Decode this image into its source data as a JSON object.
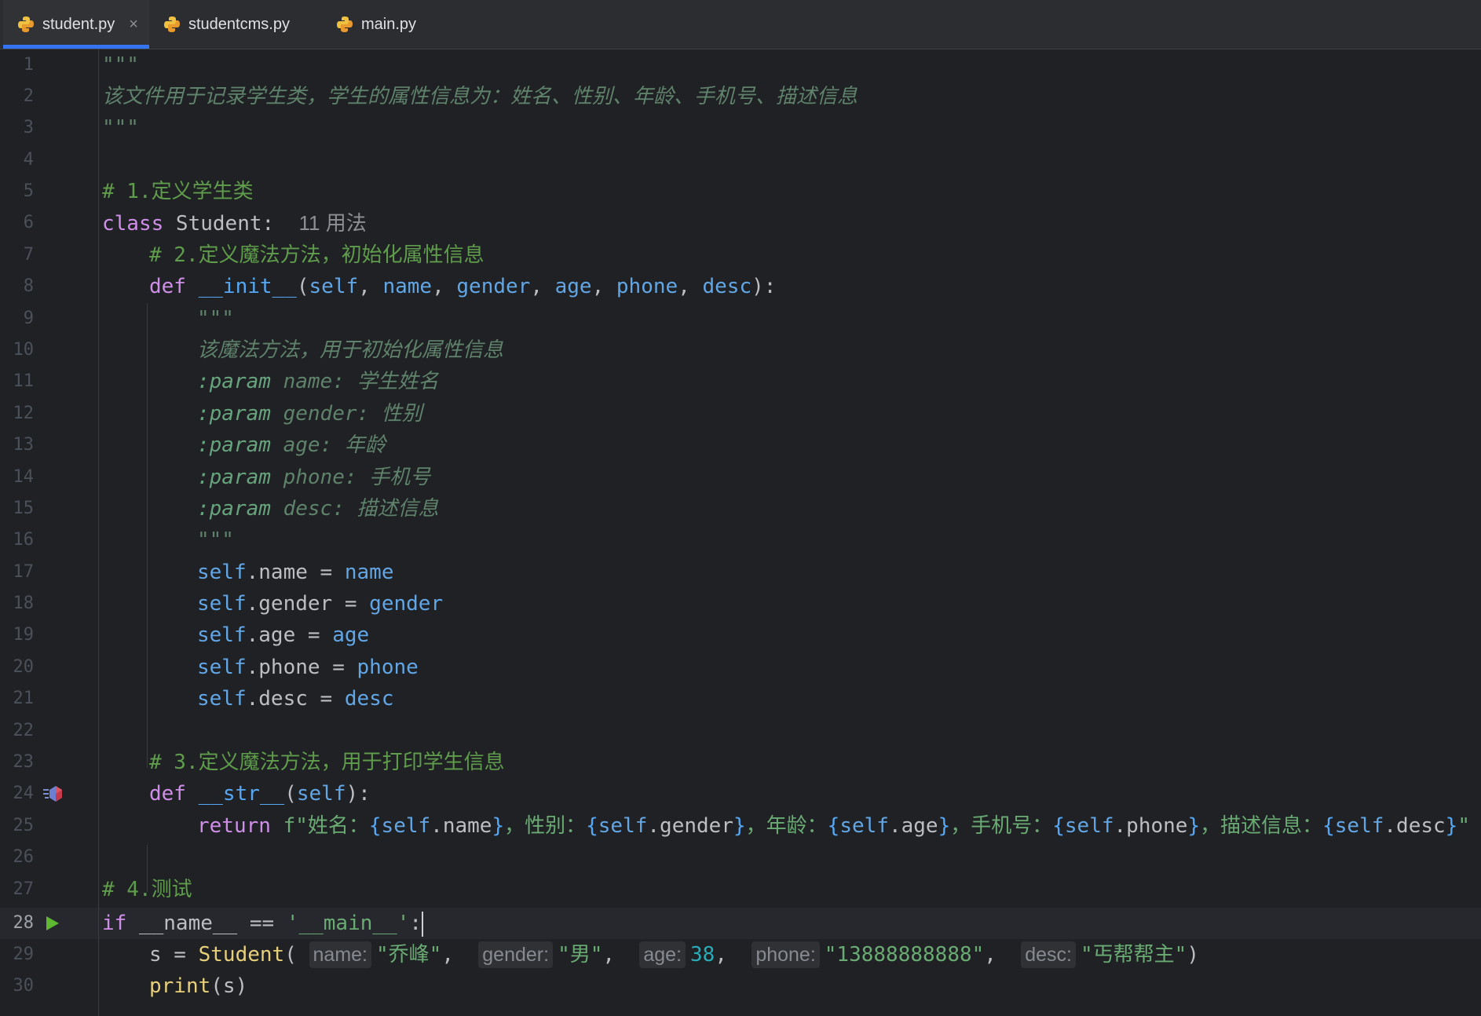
{
  "tabs": [
    {
      "label": "student.py",
      "active": true,
      "close": "×"
    },
    {
      "label": "studentcms.py",
      "active": false
    },
    {
      "label": "main.py",
      "active": false
    }
  ],
  "lines": [
    {
      "n": "1"
    },
    {
      "n": "2"
    },
    {
      "n": "3"
    },
    {
      "n": "4"
    },
    {
      "n": "5"
    },
    {
      "n": "6"
    },
    {
      "n": "7"
    },
    {
      "n": "8"
    },
    {
      "n": "9"
    },
    {
      "n": "10"
    },
    {
      "n": "11"
    },
    {
      "n": "12"
    },
    {
      "n": "13"
    },
    {
      "n": "14"
    },
    {
      "n": "15"
    },
    {
      "n": "16"
    },
    {
      "n": "17"
    },
    {
      "n": "18"
    },
    {
      "n": "19"
    },
    {
      "n": "20"
    },
    {
      "n": "21"
    },
    {
      "n": "22"
    },
    {
      "n": "23"
    },
    {
      "n": "24"
    },
    {
      "n": "25"
    },
    {
      "n": "26"
    },
    {
      "n": "27"
    },
    {
      "n": "28"
    },
    {
      "n": "29"
    },
    {
      "n": "30"
    }
  ],
  "code": {
    "l1": "\"\"\"",
    "l2": "该文件用于记录学生类，学生的属性信息为：姓名、性别、年龄、手机号、描述信息",
    "l3": "\"\"\"",
    "l5": "# 1.定义学生类",
    "l6_kw": "class",
    "l6_name": " Student:",
    "l6_hint": "11 用法",
    "l7": "# 2.定义魔法方法，初始化属性信息",
    "l8_kw": "def",
    "l8_fn": "__init__",
    "l8_p0": "(",
    "l8_self": "self",
    "l8_sep1": ", ",
    "l8_name": "name",
    "l8_sep2": ", ",
    "l8_gender": "gender",
    "l8_sep3": ", ",
    "l8_age": "age",
    "l8_sep4": ", ",
    "l8_phone": "phone",
    "l8_sep5": ", ",
    "l8_desc": "desc",
    "l8_end": "):",
    "l9": "\"\"\"",
    "l10": "该魔法方法，用于初始化属性信息",
    "l11_tag": ":param",
    "l11_txt": " name: 学生姓名",
    "l12_tag": ":param",
    "l12_txt": " gender: 性别",
    "l13_tag": ":param",
    "l13_txt": " age: 年龄",
    "l14_tag": ":param",
    "l14_txt": " phone: 手机号",
    "l15_tag": ":param",
    "l15_txt": " desc: 描述信息",
    "l16": "\"\"\"",
    "l17_self": "self",
    "l17_mid": ".name = ",
    "l17_val": "name",
    "l18_self": "self",
    "l18_mid": ".gender = ",
    "l18_val": "gender",
    "l19_self": "self",
    "l19_mid": ".age = ",
    "l19_val": "age",
    "l20_self": "self",
    "l20_mid": ".phone = ",
    "l20_val": "phone",
    "l21_self": "self",
    "l21_mid": ".desc = ",
    "l21_val": "desc",
    "l23": "# 3.定义魔法方法，用于打印学生信息",
    "l24_kw": "def",
    "l24_fn": "__str__",
    "l24_p0": "(",
    "l24_self": "self",
    "l24_end": "):",
    "l25_kw": "return",
    "l25_a": " f\"姓名：",
    "l25_b1": "{",
    "l25_b1s": "self",
    "l25_b1t": ".name",
    "l25_b1e": "}",
    "l25_c": "，性别：",
    "l25_b2": "{",
    "l25_b2s": "self",
    "l25_b2t": ".gender",
    "l25_b2e": "}",
    "l25_d": "，年龄：",
    "l25_b3": "{",
    "l25_b3s": "self",
    "l25_b3t": ".age",
    "l25_b3e": "}",
    "l25_e": "，手机号：",
    "l25_b4": "{",
    "l25_b4s": "self",
    "l25_b4t": ".phone",
    "l25_b4e": "}",
    "l25_f": "，描述信息：",
    "l25_b5": "{",
    "l25_b5s": "self",
    "l25_b5t": ".desc",
    "l25_b5e": "}",
    "l25_g": "\"",
    "l27": "# 4.测试",
    "l28_kw": "if",
    "l28_mid": " __name__ == ",
    "l28_str": "'__main__'",
    "l28_end": ":",
    "l29_a": "s = ",
    "l29_call": "Student",
    "l29_p": "(",
    "l29_h1": "name:",
    "l29_v1": "\"乔峰\"",
    "l29_s1": ",  ",
    "l29_h2": "gender:",
    "l29_v2": "\"男\"",
    "l29_s2": ",  ",
    "l29_h3": "age:",
    "l29_v3": "38",
    "l29_s3": ",  ",
    "l29_h4": "phone:",
    "l29_v4": "\"13888888888\"",
    "l29_s4": ",  ",
    "l29_h5": "desc:",
    "l29_v5": "\"丐帮帮主\"",
    "l29_end": ")",
    "l30_call": "print",
    "l30_rest": "(s)"
  },
  "colors": {
    "accent": "#3574f0",
    "background": "#1f2124"
  },
  "icons": {
    "tab": "python-icon",
    "run": "run-icon",
    "override": "override-method-icon"
  }
}
